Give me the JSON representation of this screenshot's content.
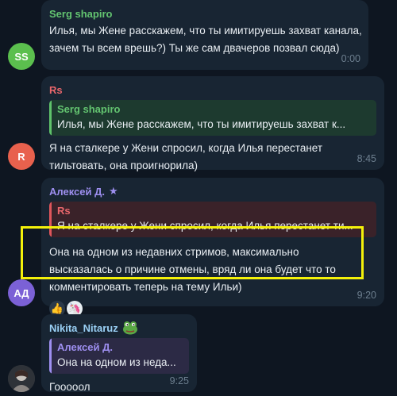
{
  "messages": [
    {
      "avatar": "SS",
      "avatar_color": "#5bbf4e",
      "sender": "Serg shapiro",
      "sender_color": "#63c470",
      "lines": [
        "Илья, мы Жене расскажем, что ты имитируешь захват канала,",
        "зачем ты всем врешь?) Ты же сам двачеров позвал сюда)"
      ],
      "time": "0:00"
    },
    {
      "avatar": "R",
      "avatar_color": "#e8614d",
      "sender": "Rs",
      "sender_color": "#e8666b",
      "reply_author": "Serg shapiro",
      "reply_text": "Илья, мы Жене расскажем, что ты имитируешь захват к...",
      "lines": [
        "Я на сталкере у Жени спросил, когда Илья перестанет",
        "тильтовать, она проигнорила)"
      ],
      "time": "8:45"
    },
    {
      "avatar": "АД",
      "avatar_color": "#7b61d6",
      "sender": "Алексей Д.",
      "sender_color": "#9e8ff0",
      "reply_author": "Rs",
      "reply_text": "Я на сталкере у Жени спросил, когда Илья перестанет ти...",
      "lines": [
        "Она на одном из недавних стримов, максимально",
        "высказалась о причине отмены, вряд ли она будет что то",
        "комментировать теперь на тему Ильи)"
      ],
      "reactions": [
        "👍",
        "🦄"
      ],
      "time": "9:20"
    },
    {
      "sender": "Nikita_Nitaruz",
      "sender_color": "#9ad0f5",
      "reply_author": "Алексей Д.",
      "reply_text": "Она на одном из неда...",
      "lines": [
        "Гооооол"
      ],
      "time": "9:25"
    }
  ],
  "icons": {
    "star": "star-icon",
    "sticker": "frog-sticker-icon"
  }
}
